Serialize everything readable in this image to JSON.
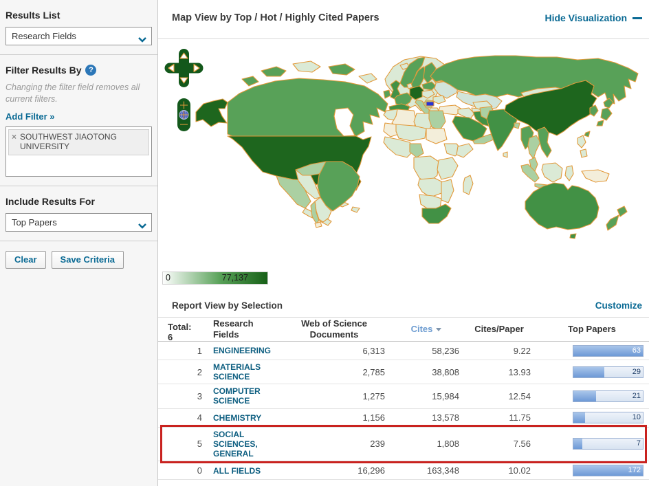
{
  "sidebar": {
    "results_list": {
      "label": "Results List",
      "value": "Research Fields"
    },
    "filter": {
      "heading": "Filter Results By",
      "help_icon": "?",
      "note": "Changing the filter field removes all current filters.",
      "add_filter_label": "Add Filter »",
      "chip": {
        "remove_icon": "×",
        "text": "SOUTHWEST JIAOTONG UNIVERSITY"
      }
    },
    "include": {
      "label": "Include Results For",
      "value": "Top Papers"
    },
    "buttons": {
      "clear": "Clear",
      "save": "Save Criteria"
    }
  },
  "map": {
    "title": "Map View by Top / Hot / Highly Cited Papers",
    "hide_label": "Hide Visualization",
    "legend": {
      "min": "0",
      "max": "77,137"
    }
  },
  "report": {
    "title": "Report View by Selection",
    "customize_label": "Customize",
    "table": {
      "total_label": "Total:",
      "total_value": "6",
      "columns": [
        "Research Fields",
        "Web of Science Documents",
        "Cites",
        "Cites/Paper",
        "Top Papers"
      ],
      "sorted_column": "Cites",
      "rows": [
        {
          "rank": "1",
          "field": "ENGINEERING",
          "wos_documents": "6,313",
          "cites": "58,236",
          "cites_per_paper": "9.22",
          "top_papers": "63",
          "bar_pct": 100,
          "highlighted": false
        },
        {
          "rank": "2",
          "field": "MATERIALS SCIENCE",
          "wos_documents": "2,785",
          "cites": "38,808",
          "cites_per_paper": "13.93",
          "top_papers": "29",
          "bar_pct": 45,
          "highlighted": false
        },
        {
          "rank": "3",
          "field": "COMPUTER SCIENCE",
          "wos_documents": "1,275",
          "cites": "15,984",
          "cites_per_paper": "12.54",
          "top_papers": "21",
          "bar_pct": 33,
          "highlighted": false
        },
        {
          "rank": "4",
          "field": "CHEMISTRY",
          "wos_documents": "1,156",
          "cites": "13,578",
          "cites_per_paper": "11.75",
          "top_papers": "10",
          "bar_pct": 17,
          "highlighted": false
        },
        {
          "rank": "5",
          "field": "SOCIAL SCIENCES, GENERAL",
          "wos_documents": "239",
          "cites": "1,808",
          "cites_per_paper": "7.56",
          "top_papers": "7",
          "bar_pct": 13,
          "highlighted": true
        },
        {
          "rank": "0",
          "field": "ALL FIELDS",
          "wos_documents": "16,296",
          "cites": "163,348",
          "cites_per_paper": "10.02",
          "top_papers": "172",
          "bar_pct": 100,
          "highlighted": false
        }
      ]
    }
  },
  "colors": {
    "link_teal": "#0a6a94",
    "field_link": "#0d5e80",
    "sorted_header_blue": "#6d9cd1",
    "highlight_red": "#c9221f",
    "map_dark_green": "#1e661e",
    "map_border_orange": "#e2993a",
    "bar_fill_blue": "#6d99d6",
    "selected_country_blue": "#2433d9"
  }
}
